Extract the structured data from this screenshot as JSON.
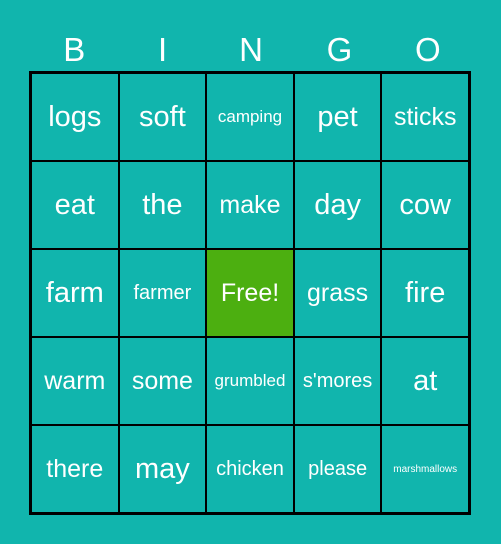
{
  "header": [
    "B",
    "I",
    "N",
    "G",
    "O"
  ],
  "cells": [
    [
      "logs",
      "soft",
      "camping",
      "pet",
      "sticks"
    ],
    [
      "eat",
      "the",
      "make",
      "day",
      "cow"
    ],
    [
      "farm",
      "farmer",
      "Free!",
      "grass",
      "fire"
    ],
    [
      "warm",
      "some",
      "grumbled",
      "s'mores",
      "at"
    ],
    [
      "there",
      "may",
      "chicken",
      "please",
      "marshmallows"
    ]
  ],
  "colors": {
    "background": "#11b5ad",
    "free_cell": "#4caf10",
    "grid_lines": "#000000",
    "text": "#ffffff"
  }
}
